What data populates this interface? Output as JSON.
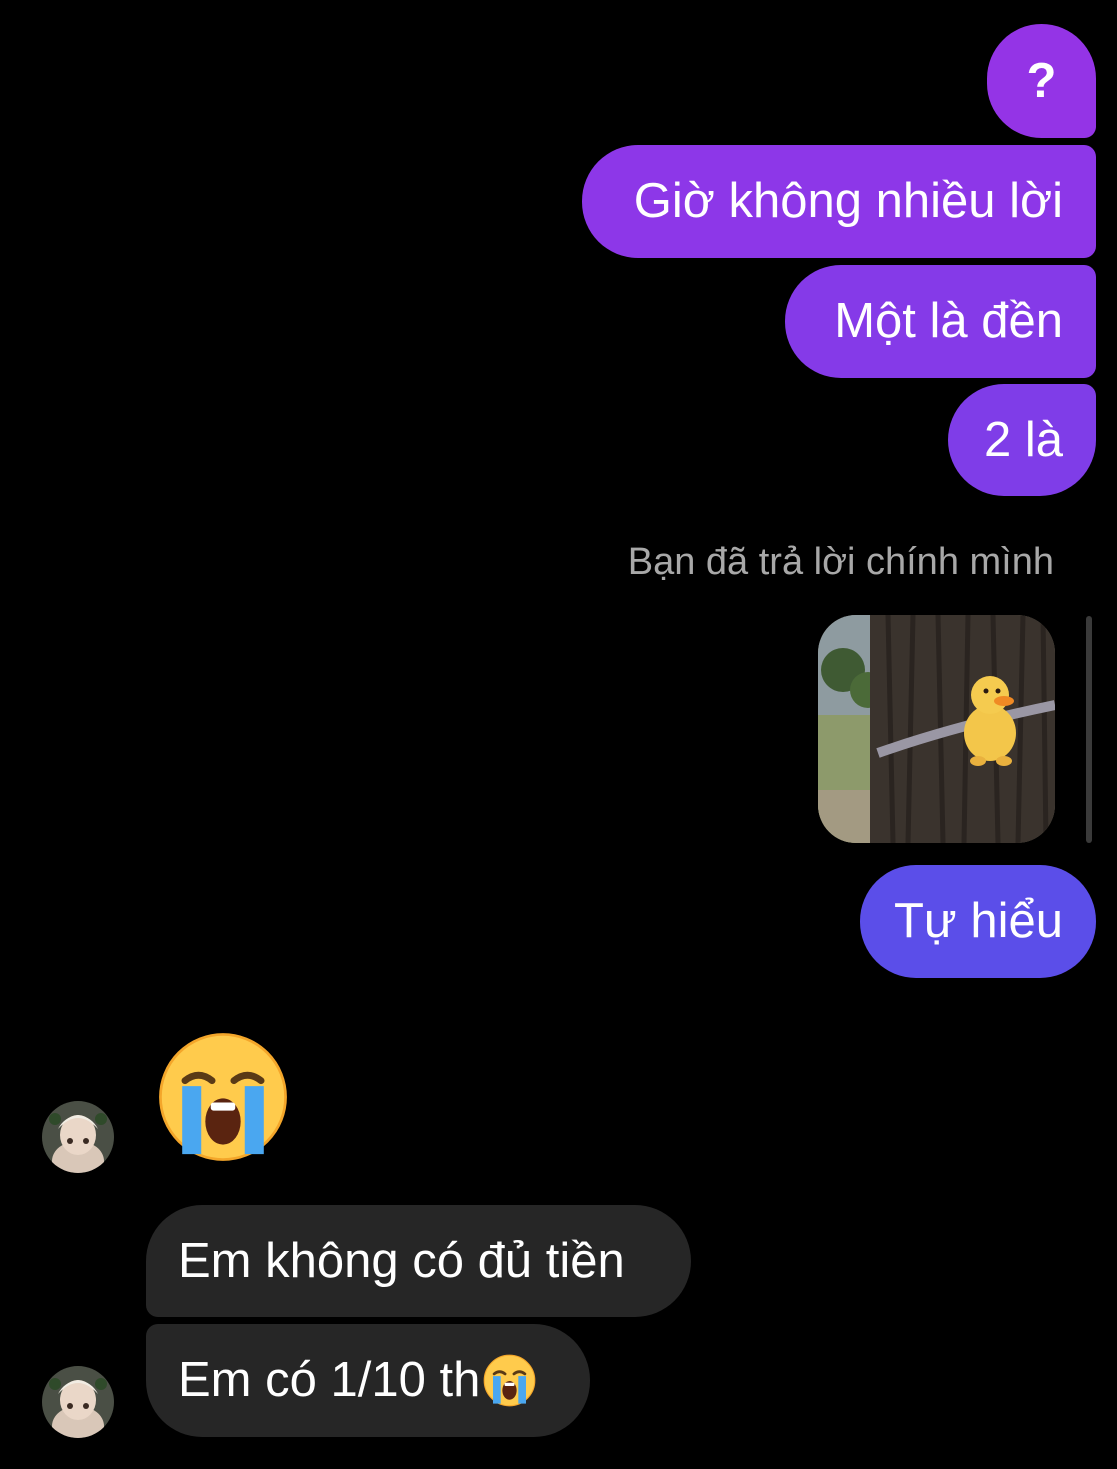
{
  "colors": {
    "background": "#000000",
    "outgoing_top": "#9434e6",
    "outgoing_bottom": "#5b4ee9",
    "incoming": "#262626",
    "meta_text": "#a8a8a8"
  },
  "messages_out": [
    {
      "text": "?"
    },
    {
      "text": "Giờ không nhiều lời"
    },
    {
      "text": "Một là đền"
    },
    {
      "text": "2 là"
    },
    {
      "text": "Tự hiểu"
    }
  ],
  "reply_note": "Bạn đã trả lời chính mình",
  "replied_photo": {
    "icon": "duck-plush-on-tree-photo"
  },
  "incoming": {
    "emoji": {
      "icon": "loudly-crying-face-emoji"
    },
    "messages": [
      {
        "text": "Em không có đủ tiền"
      },
      {
        "text": "Em có 1/10 th",
        "trailing_icon": "loudly-crying-face-emoji"
      }
    ],
    "avatar": {
      "icon": "contact-avatar"
    }
  }
}
